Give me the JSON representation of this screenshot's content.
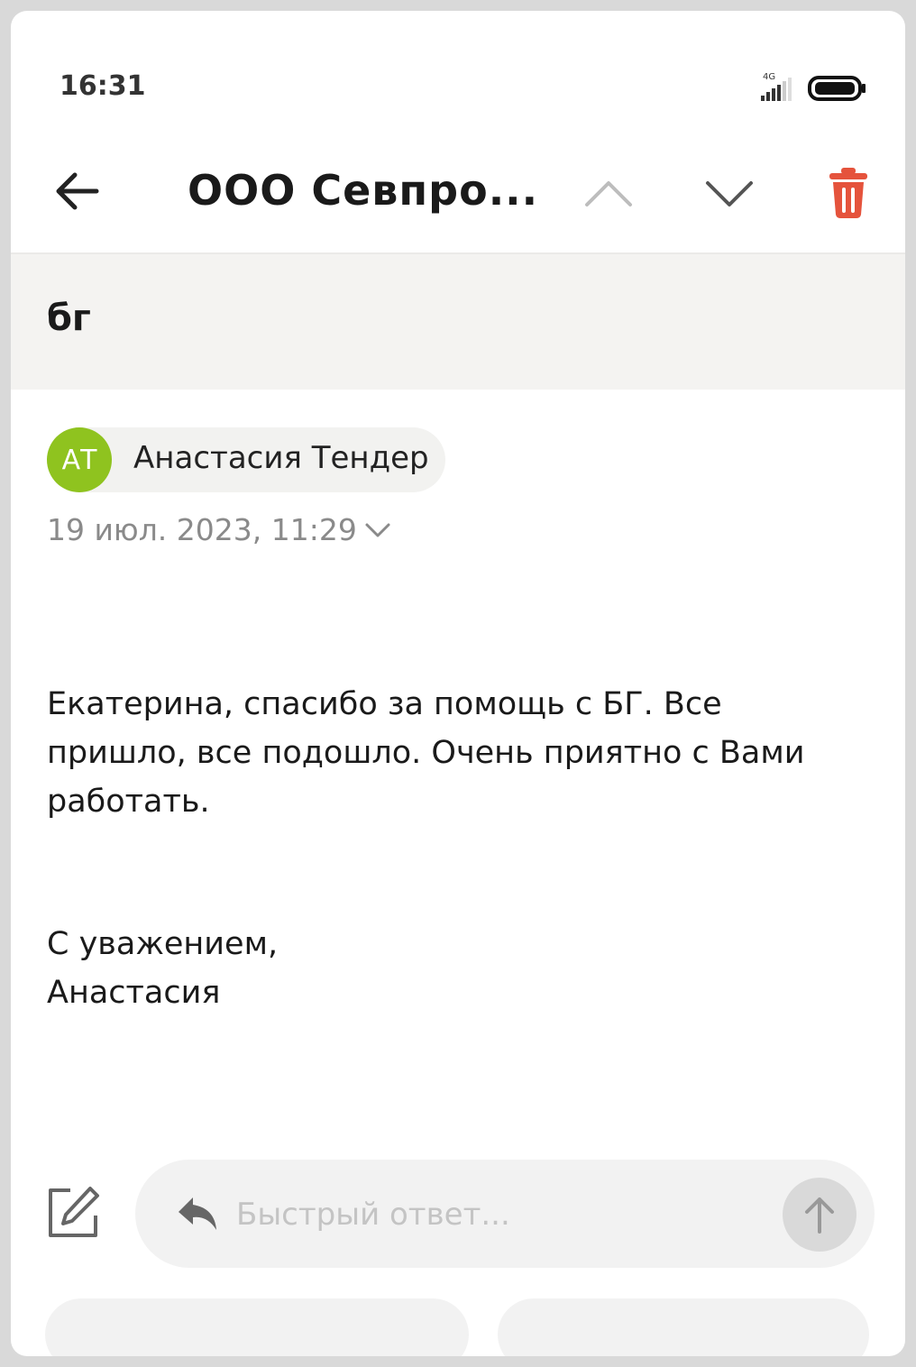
{
  "status_bar": {
    "time": "16:31",
    "network_label": "4G",
    "signal_icon": "signal-icon",
    "battery_icon": "battery-icon"
  },
  "toolbar": {
    "back_icon": "arrow-left-icon",
    "title": "ООО Севпро...",
    "prev_icon": "chevron-up-icon",
    "next_icon": "chevron-down-icon",
    "delete_icon": "trash-icon",
    "delete_color": "#e5533c"
  },
  "message": {
    "subject": "бг",
    "sender": {
      "initials": "АТ",
      "name": "Анастасия Тендер",
      "avatar_color": "#8fc31f"
    },
    "date": "19 июл. 2023, 11:29",
    "body": "Екатерина, спасибо за помощь с БГ. Все пришло, все подошло. Очень приятно с Вами работать.",
    "signature_line1": "С уважением,",
    "signature_line2": "Анастасия"
  },
  "reply": {
    "compose_icon": "compose-icon",
    "reply_icon": "reply-icon",
    "placeholder": "Быстрый ответ...",
    "send_icon": "arrow-up-icon"
  }
}
